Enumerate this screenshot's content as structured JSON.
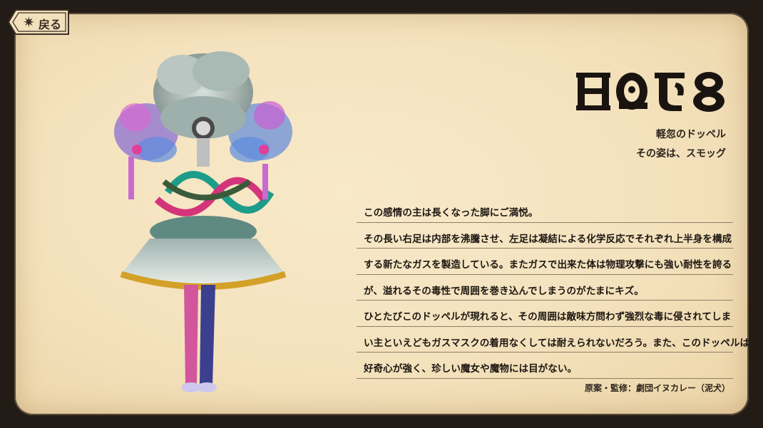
{
  "header": {
    "back_label": "戻る",
    "back_icon": "sparkle-icon",
    "title_glyphs": "witch-rune-script"
  },
  "subtitle": {
    "line1": "軽忽のドッペル",
    "line2": "その姿は、スモッグ"
  },
  "description": {
    "lines": [
      "この感情の主は長くなった脚にご満悦。",
      "その長い右足は内部を沸騰させ、左足は凝結による化学反応でそれぞれ上半身を構成",
      "する新たなガスを製造している。またガスで出来た体は物理攻撃にも強い耐性を誇る",
      "が、溢れるその毒性で周囲を巻き込んでしまうのがたまにキズ。",
      "ひとたびこのドッペルが現れると、その周囲は敵味方問わず強烈な毒に侵されてしま",
      "い主といえどもガスマスクの着用なくしては耐えられないだろう。また、このドッペルは",
      "好奇心が強く、珍しい魔女や魔物には目がない。"
    ]
  },
  "credit": "原案・監修：劇団イヌカレー（泥犬）",
  "colors": {
    "paper": "#f4e2bd",
    "frame": "#231c16",
    "text": "#1d1712",
    "rule": "#8f7d68"
  }
}
